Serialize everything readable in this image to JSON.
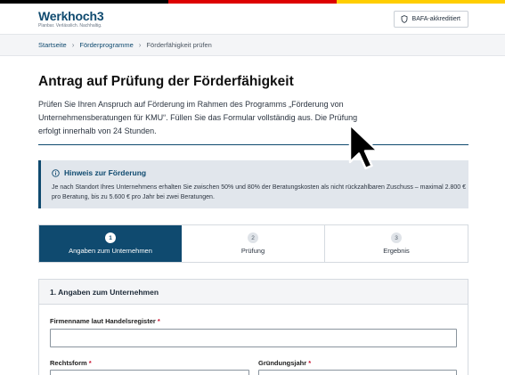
{
  "header": {
    "logo_name": "Werkhoch3",
    "logo_tagline": "Planbar. Verlässlich. Nachhaltig.",
    "badge_label": "BAFA-akkreditiert",
    "badge_icon": "shield-icon"
  },
  "breadcrumb": {
    "items": [
      "Startseite",
      "Förderprogramme",
      "Förderfähigkeit prüfen"
    ],
    "separator": "›"
  },
  "main": {
    "title": "Antrag auf Prüfung der Förderfähigkeit",
    "intro": "Prüfen Sie Ihren Anspruch auf Förderung im Rahmen des Programms „Förderung von Unternehmensberatungen für KMU“. Füllen Sie das Formular vollständig aus. Die Prüfung erfolgt innerhalb von 24 Stunden."
  },
  "notice": {
    "icon": "info-icon",
    "title": "Hinweis zur Förderung",
    "body": "Je nach Standort Ihres Unternehmens erhalten Sie zwischen 50% und 80% der Beratungskosten als nicht rückzahlbaren Zuschuss – maximal 2.800 € pro Beratung, bis zu 5.600 € pro Jahr bei zwei Beratungen."
  },
  "steps": [
    {
      "number": "1",
      "label": "Angaben zum Unternehmen",
      "active": true
    },
    {
      "number": "2",
      "label": "Prüfung",
      "active": false
    },
    {
      "number": "3",
      "label": "Ergebnis",
      "active": false
    }
  ],
  "form": {
    "section_title": "1. Angaben zum Unternehmen",
    "required_marker": "*",
    "fields": {
      "company_name": {
        "label": "Firmenname laut Handelsregister",
        "value": ""
      },
      "legal_form": {
        "label": "Rechtsform",
        "value": ""
      },
      "founding_year": {
        "label": "Gründungsjahr",
        "value": ""
      }
    }
  },
  "colors": {
    "primary": "#0f4a6f",
    "notice_bg": "#e1e6ec",
    "required": "#c8102e",
    "flag": [
      "#000000",
      "#dd0000",
      "#ffce00"
    ]
  }
}
